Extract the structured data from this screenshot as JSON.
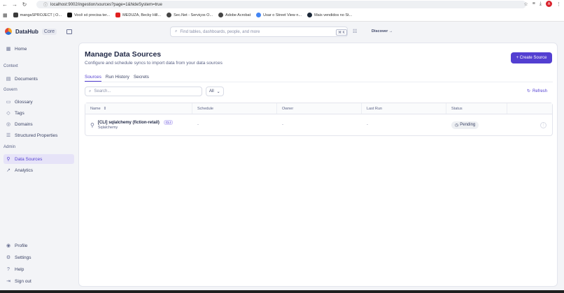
{
  "browser": {
    "url": "localhost:9002/ingestion/sources?page=1&hideSystem=true",
    "profile_initial": "A",
    "bookmarks": [
      {
        "label": "mangaSPROJECT | O...",
        "icon": "generic-site-icon",
        "color": "#3b3b3b"
      },
      {
        "label": "Você só precisa ter...",
        "icon": "notion-icon",
        "color": "#111111"
      },
      {
        "label": "MEDUZA, Becky Hill...",
        "icon": "youtube-icon",
        "color": "#e02020"
      },
      {
        "label": "Sec.Net - Serviços O...",
        "icon": "globe-icon",
        "color": "#444444"
      },
      {
        "label": "Adobe Acrobat",
        "icon": "globe-icon",
        "color": "#444444"
      },
      {
        "label": "Usar o Street View n...",
        "icon": "google-icon",
        "color": "#4285f4"
      },
      {
        "label": "Mais vendidos no St...",
        "icon": "steam-icon",
        "color": "#1b2838"
      }
    ]
  },
  "sidebar": {
    "brand": "DataHub",
    "brand_badge": "Core",
    "home": {
      "label": "Home",
      "icon": "grid-icon"
    },
    "sections": {
      "context": "Context",
      "govern": "Govern",
      "admin": "Admin"
    },
    "context_items": [
      {
        "label": "Documents",
        "icon": "document-icon"
      }
    ],
    "govern_items": [
      {
        "label": "Glossary",
        "icon": "book-icon"
      },
      {
        "label": "Tags",
        "icon": "tag-icon"
      },
      {
        "label": "Domains",
        "icon": "globe-icon"
      },
      {
        "label": "Structured Properties",
        "icon": "list-icon"
      }
    ],
    "admin_items": [
      {
        "label": "Data Sources",
        "icon": "plug-icon",
        "active": true
      },
      {
        "label": "Analytics",
        "icon": "chart-icon"
      }
    ],
    "footer_items": [
      {
        "label": "Profile",
        "icon": "user-icon"
      },
      {
        "label": "Settings",
        "icon": "gear-icon"
      },
      {
        "label": "Help",
        "icon": "help-icon"
      },
      {
        "label": "Sign out",
        "icon": "signout-icon"
      }
    ]
  },
  "topbar": {
    "search_placeholder": "Find tables, dashboards, people, and more",
    "shortcut": "⌘ K",
    "discover_label": "Discover →"
  },
  "main": {
    "title": "Manage Data Sources",
    "subtitle": "Configure and schedule syncs to import data from your data sources",
    "create_button": "+ Create Source",
    "tabs": [
      {
        "label": "Sources",
        "active": true
      },
      {
        "label": "Run History",
        "active": false
      },
      {
        "label": "Secrets",
        "active": false
      }
    ],
    "search_placeholder": "Search...",
    "type_filter": "All",
    "refresh_label": "Refresh",
    "table": {
      "columns": [
        "Name",
        "Schedule",
        "Owner",
        "Last Run",
        "Status",
        ""
      ],
      "rows": [
        {
          "name": "[CLI] sqlalchemy (fiction-retail)",
          "type": "Sqlalchemy",
          "badge": "CLI",
          "schedule": "-",
          "owner": "-",
          "last_run": "-",
          "status": "Pending"
        }
      ]
    }
  },
  "colors": {
    "accent": "#533fd1",
    "background": "#f3f4f7",
    "panel": "#ffffff"
  }
}
